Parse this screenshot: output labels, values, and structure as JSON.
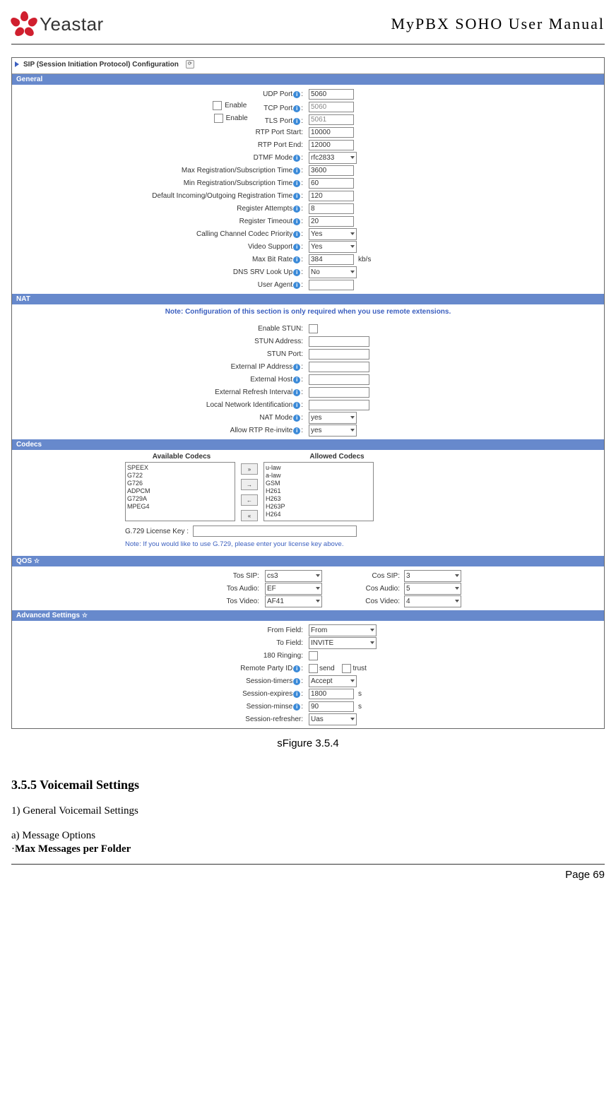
{
  "header": {
    "logo_text": "Yeastar",
    "doc_title": "MyPBX SOHO User Manual"
  },
  "sip_config": {
    "title": "SIP (Session Initiation Protocol) Configuration",
    "sections": {
      "general": {
        "title": "General",
        "enable_tcp_label": "Enable",
        "enable_tls_label": "Enable",
        "fields": {
          "udp_port": {
            "label": "UDP Port",
            "value": "5060"
          },
          "tcp_port": {
            "label": "TCP Port",
            "value": "5060"
          },
          "tls_port": {
            "label": "TLS Port",
            "value": "5061"
          },
          "rtp_start": {
            "label": "RTP Port Start:",
            "value": "10000"
          },
          "rtp_end": {
            "label": "RTP Port End:",
            "value": "12000"
          },
          "dtmf_mode": {
            "label": "DTMF Mode",
            "value": "rfc2833"
          },
          "max_reg": {
            "label": "Max Registration/Subscription Time",
            "value": "3600"
          },
          "min_reg": {
            "label": "Min Registration/Subscription Time",
            "value": "60"
          },
          "def_reg": {
            "label": "Default Incoming/Outgoing Registration Time",
            "value": "120"
          },
          "reg_attempts": {
            "label": "Register Attempts",
            "value": "8"
          },
          "reg_timeout": {
            "label": "Register Timeout",
            "value": "20"
          },
          "codec_priority": {
            "label": "Calling Channel Codec Priority",
            "value": "Yes"
          },
          "video_support": {
            "label": "Video Support",
            "value": "Yes"
          },
          "max_bitrate": {
            "label": "Max Bit Rate",
            "value": "384",
            "unit": "kb/s"
          },
          "dns_srv": {
            "label": "DNS SRV Look Up",
            "value": "No"
          },
          "user_agent": {
            "label": "User Agent",
            "value": ""
          }
        }
      },
      "nat": {
        "title": "NAT",
        "note": "Note: Configuration of this section is only required when you use remote extensions.",
        "fields": {
          "enable_stun": {
            "label": "Enable STUN:"
          },
          "stun_addr": {
            "label": "STUN Address:",
            "value": ""
          },
          "stun_port": {
            "label": "STUN Port:",
            "value": ""
          },
          "ext_ip": {
            "label": "External IP Address",
            "value": ""
          },
          "ext_host": {
            "label": "External Host",
            "value": ""
          },
          "ext_refresh": {
            "label": "External Refresh Interval",
            "value": ""
          },
          "local_net": {
            "label": "Local Network Identification",
            "value": ""
          },
          "nat_mode": {
            "label": "NAT Mode",
            "value": "yes"
          },
          "allow_rtp": {
            "label": "Allow RTP Re-invite",
            "value": "yes"
          }
        }
      },
      "codecs": {
        "title": "Codecs",
        "available_label": "Available Codecs",
        "allowed_label": "Allowed Codecs",
        "available": [
          "SPEEX",
          "G722",
          "G726",
          "ADPCM",
          "G729A",
          "MPEG4"
        ],
        "allowed": [
          "u-law",
          "a-law",
          "GSM",
          "H261",
          "H263",
          "H263P",
          "H264"
        ],
        "license_label": "G.729 License Key :",
        "note": "Note: If you would like to use G.729, please enter your license key above."
      },
      "qos": {
        "title": "QOS",
        "fields": {
          "tos_sip": {
            "label": "Tos SIP:",
            "value": "cs3"
          },
          "cos_sip": {
            "label": "Cos SIP:",
            "value": "3"
          },
          "tos_audio": {
            "label": "Tos Audio:",
            "value": "EF"
          },
          "cos_audio": {
            "label": "Cos Audio:",
            "value": "5"
          },
          "tos_video": {
            "label": "Tos Video:",
            "value": "AF41"
          },
          "cos_video": {
            "label": "Cos Video:",
            "value": "4"
          }
        }
      },
      "advanced": {
        "title": "Advanced Settings",
        "fields": {
          "from_field": {
            "label": "From Field:",
            "value": "From"
          },
          "to_field": {
            "label": "To Field:",
            "value": "INVITE"
          },
          "ringing_180": {
            "label": "180 Ringing:"
          },
          "remote_party": {
            "label": "Remote Party ID",
            "send": "send",
            "trust": "trust"
          },
          "session_timers": {
            "label": "Session-timers",
            "value": "Accept"
          },
          "session_expires": {
            "label": "Session-expires",
            "value": "1800",
            "unit": "s"
          },
          "session_minse": {
            "label": "Session-minse",
            "value": "90",
            "unit": "s"
          },
          "session_refresher": {
            "label": "Session-refresher:",
            "value": "Uas"
          }
        }
      }
    }
  },
  "caption": "sFigure 3.5.4",
  "section": {
    "heading": "3.5.5 Voicemail Settings",
    "sub1": "1) General Voicemail Settings",
    "sub2": "a) Message Options",
    "bullet": "Max Messages per Folder"
  },
  "footer": {
    "page": "Page 69"
  }
}
